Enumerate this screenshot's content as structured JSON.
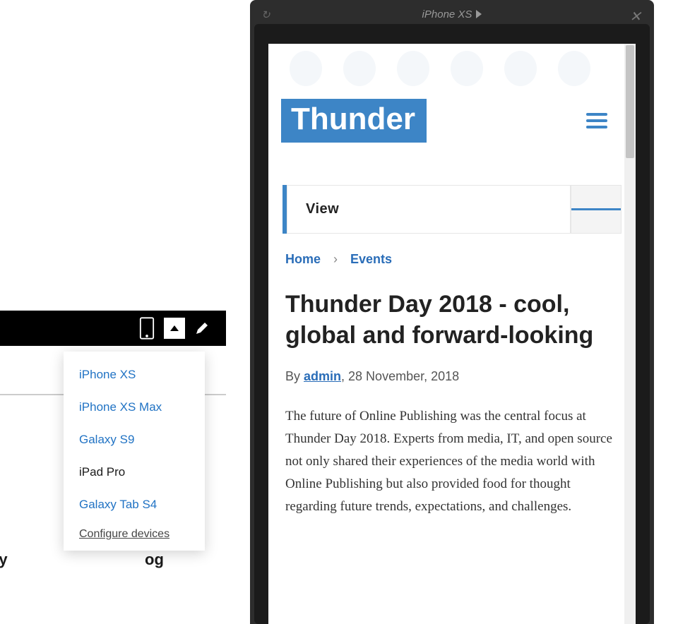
{
  "left": {
    "visible_text_left": "My",
    "visible_text_right": "og",
    "devices": [
      {
        "label": "iPhone XS",
        "selected": false
      },
      {
        "label": "iPhone XS Max",
        "selected": false
      },
      {
        "label": "Galaxy S9",
        "selected": false
      },
      {
        "label": "iPad Pro",
        "selected": true
      },
      {
        "label": "Galaxy Tab S4",
        "selected": false
      }
    ],
    "configure_label": "Configure devices"
  },
  "preview": {
    "device_label": "iPhone XS",
    "site_logo_text": "Thunder",
    "view_tab": "View",
    "breadcrumb": {
      "home": "Home",
      "section": "Events"
    },
    "article": {
      "title": "Thunder Day 2018 - cool, global and forward-looking",
      "by_prefix": "By ",
      "author": "admin",
      "date": ", 28 November, 2018",
      "body": "The future of Online Publishing was the central focus at Thunder Day 2018. Experts from media, IT, and open source not only shared their experiences of the media world with Online Publishing but also provided food for thought regarding future trends, expectations, and challenges."
    }
  }
}
